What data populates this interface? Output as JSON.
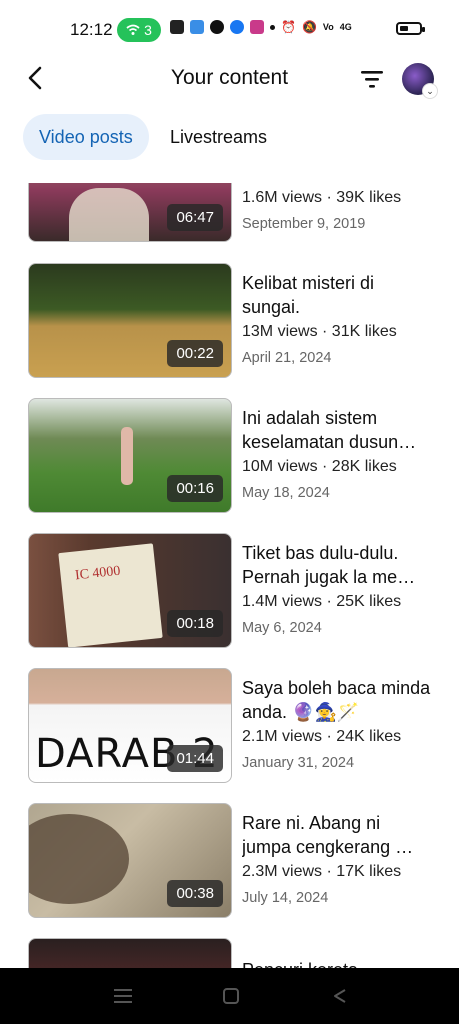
{
  "status": {
    "time": "12:12",
    "wifi_count": "3",
    "signal_text": "4G"
  },
  "header": {
    "title": "Your content",
    "back_icon": "back-arrow-icon",
    "filter_icon": "filter-icon"
  },
  "tabs": [
    {
      "label": "Video posts",
      "active": true
    },
    {
      "label": "Livestreams",
      "active": false
    }
  ],
  "videos": [
    {
      "title": "",
      "stats": "1.6M views · 39K likes",
      "date": "September 9, 2019",
      "duration": "06:47"
    },
    {
      "title": "Kelibat misteri di sungai.",
      "stats": "13M views · 31K likes",
      "date": "April 21, 2024",
      "duration": "00:22"
    },
    {
      "title": "Ini adalah sistem keselamatan dusun…",
      "stats": "10M views · 28K likes",
      "date": "May 18, 2024",
      "duration": "00:16"
    },
    {
      "title": "Tiket bas dulu-dulu. Pernah jugak la me…",
      "stats": "1.4M views · 25K likes",
      "date": "May 6, 2024",
      "duration": "00:18"
    },
    {
      "title": "Saya boleh baca minda anda. 🔮🧙‍♀️🪄",
      "stats": "2.1M views · 24K likes",
      "date": "January 31, 2024",
      "duration": "01:44"
    },
    {
      "title": "Rare ni. Abang ni jumpa cengkerang …",
      "stats": "2.3M views · 17K likes",
      "date": "July 14, 2024",
      "duration": "00:38"
    },
    {
      "title": "Pencuri kereta",
      "stats": "",
      "date": "",
      "duration": ""
    }
  ],
  "thumb_text": {
    "ticket": "IC 4000",
    "sign": "DARAB 2"
  }
}
